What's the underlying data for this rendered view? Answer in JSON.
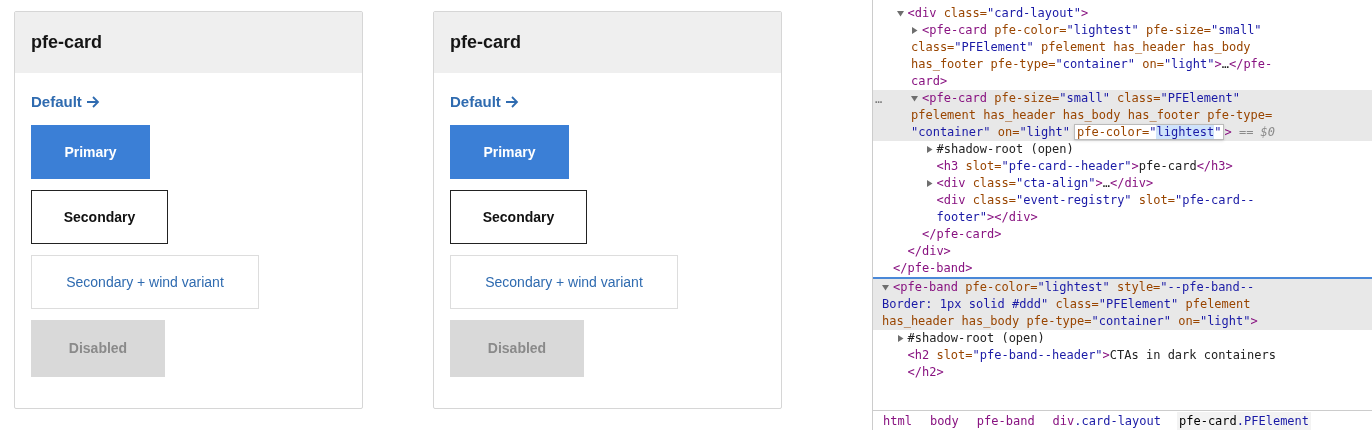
{
  "cards": [
    {
      "header": "pfe-card",
      "link": "Default",
      "buttons": [
        {
          "label": "Primary",
          "kind": "primary"
        },
        {
          "label": "Secondary",
          "kind": "secondary"
        },
        {
          "label": "Secondary + wind variant",
          "kind": "wind"
        },
        {
          "label": "Disabled",
          "kind": "disabled"
        }
      ]
    },
    {
      "header": "pfe-card",
      "link": "Default",
      "buttons": [
        {
          "label": "Primary",
          "kind": "primary"
        },
        {
          "label": "Secondary",
          "kind": "secondary"
        },
        {
          "label": "Secondary + wind variant",
          "kind": "wind"
        },
        {
          "label": "Disabled",
          "kind": "disabled"
        }
      ]
    }
  ],
  "elements": [
    {
      "closing": [
        {
          "kind": "tag",
          "text": "</pfe-band>"
        }
      ],
      "children": [
        {
          "highlighted": false,
          "expanded": true,
          "lines": [
            [
              {
                "kind": "tag",
                "text": "<div"
              },
              {
                "kind": "attr",
                "text": " class="
              },
              {
                "kind": "val",
                "text": "\"card-layout\""
              },
              {
                "kind": "tag",
                "text": ">"
              }
            ]
          ],
          "closing": [
            {
              "kind": "tag",
              "text": "</div>"
            }
          ],
          "children": [
            {
              "highlighted": false,
              "expanded": false,
              "lines": [
                [
                  {
                    "kind": "tag",
                    "text": "<pfe-card"
                  },
                  {
                    "kind": "attr",
                    "text": " pfe-color="
                  },
                  {
                    "kind": "val",
                    "text": "\"lightest\""
                  },
                  {
                    "kind": "attr",
                    "text": " pfe-size="
                  },
                  {
                    "kind": "val",
                    "text": "\"small\""
                  }
                ],
                [
                  {
                    "kind": "attr",
                    "text": "class="
                  },
                  {
                    "kind": "val",
                    "text": "\"PFElement\""
                  },
                  {
                    "kind": "attr",
                    "text": " pfelement has_header has_body"
                  }
                ],
                [
                  {
                    "kind": "attr",
                    "text": "has_footer pfe-type="
                  },
                  {
                    "kind": "val",
                    "text": "\"container\""
                  },
                  {
                    "kind": "attr",
                    "text": " on="
                  },
                  {
                    "kind": "val",
                    "text": "\"light\""
                  },
                  {
                    "kind": "tag",
                    "text": ">"
                  },
                  {
                    "kind": "plain",
                    "text": "…"
                  },
                  {
                    "kind": "tag",
                    "text": "</pfe-"
                  }
                ],
                [
                  {
                    "kind": "tag",
                    "text": "card>"
                  }
                ]
              ]
            },
            {
              "highlighted": true,
              "gutter": "…",
              "expanded": true,
              "lines": [
                [
                  {
                    "kind": "tag",
                    "text": "<pfe-card"
                  },
                  {
                    "kind": "attr",
                    "text": " pfe-size="
                  },
                  {
                    "kind": "val",
                    "text": "\"small\""
                  },
                  {
                    "kind": "attr",
                    "text": " class="
                  },
                  {
                    "kind": "val",
                    "text": "\"PFElement\""
                  }
                ],
                [
                  {
                    "kind": "attr",
                    "text": "pfelement has_header has_body has_footer pfe-type="
                  }
                ],
                [
                  {
                    "kind": "val",
                    "text": "\"container\""
                  },
                  {
                    "kind": "attr",
                    "text": " on="
                  },
                  {
                    "kind": "val",
                    "text": "\"light\""
                  },
                  {
                    "kind": "edit",
                    "parts": [
                      {
                        "kind": "attr",
                        "text": "pfe-color="
                      },
                      {
                        "kind": "val",
                        "text": "\""
                      },
                      {
                        "kind": "sel",
                        "text": "lightest"
                      },
                      {
                        "kind": "val",
                        "text": "\""
                      }
                    ]
                  },
                  {
                    "kind": "tag",
                    "text": ">"
                  },
                  {
                    "kind": "dim",
                    "text": " == $0"
                  }
                ]
              ],
              "closing": [
                {
                  "kind": "tag",
                  "text": "</pfe-card>"
                }
              ],
              "children": [
                {
                  "highlighted": false,
                  "expanded": false,
                  "lines": [
                    [
                      {
                        "kind": "plain",
                        "text": "#shadow-root (open)"
                      }
                    ]
                  ]
                },
                {
                  "highlighted": false,
                  "lines": [
                    [
                      {
                        "kind": "tag",
                        "text": "<h3"
                      },
                      {
                        "kind": "attr",
                        "text": " slot="
                      },
                      {
                        "kind": "val",
                        "text": "\"pfe-card--header\""
                      },
                      {
                        "kind": "tag",
                        "text": ">"
                      },
                      {
                        "kind": "plain",
                        "text": "pfe-card"
                      },
                      {
                        "kind": "tag",
                        "text": "</h3>"
                      }
                    ]
                  ]
                },
                {
                  "highlighted": false,
                  "expanded": false,
                  "lines": [
                    [
                      {
                        "kind": "tag",
                        "text": "<div"
                      },
                      {
                        "kind": "attr",
                        "text": " class="
                      },
                      {
                        "kind": "val",
                        "text": "\"cta-align\""
                      },
                      {
                        "kind": "tag",
                        "text": ">"
                      },
                      {
                        "kind": "plain",
                        "text": "…"
                      },
                      {
                        "kind": "tag",
                        "text": "</div>"
                      }
                    ]
                  ]
                },
                {
                  "highlighted": false,
                  "lines": [
                    [
                      {
                        "kind": "tag",
                        "text": "<div"
                      },
                      {
                        "kind": "attr",
                        "text": " class="
                      },
                      {
                        "kind": "val",
                        "text": "\"event-registry\""
                      },
                      {
                        "kind": "attr",
                        "text": " slot="
                      },
                      {
                        "kind": "val",
                        "text": "\"pfe-card--"
                      }
                    ],
                    [
                      {
                        "kind": "val",
                        "text": "footer\""
                      },
                      {
                        "kind": "tag",
                        "text": "></div>"
                      }
                    ]
                  ]
                }
              ]
            }
          ]
        }
      ]
    },
    {
      "highlighted": true,
      "drop_line": true,
      "expanded": true,
      "lines": [
        [
          {
            "kind": "tag",
            "text": "<pfe-band"
          },
          {
            "kind": "attr",
            "text": " pfe-color="
          },
          {
            "kind": "val",
            "text": "\"lightest\""
          },
          {
            "kind": "attr",
            "text": " style="
          },
          {
            "kind": "val",
            "text": "\"--pfe-band--"
          }
        ],
        [
          {
            "kind": "val",
            "text": "Border: 1px solid #ddd\""
          },
          {
            "kind": "attr",
            "text": " class="
          },
          {
            "kind": "val",
            "text": "\"PFElement\""
          },
          {
            "kind": "attr",
            "text": " pfelement"
          }
        ],
        [
          {
            "kind": "attr",
            "text": "has_header has_body pfe-type="
          },
          {
            "kind": "val",
            "text": "\"container\""
          },
          {
            "kind": "attr",
            "text": " on="
          },
          {
            "kind": "val",
            "text": "\"light\""
          },
          {
            "kind": "tag",
            "text": ">"
          }
        ]
      ],
      "children": [
        {
          "highlighted": false,
          "expanded": false,
          "lines": [
            [
              {
                "kind": "plain",
                "text": "#shadow-root (open)"
              }
            ]
          ]
        },
        {
          "highlighted": false,
          "lines": [
            [
              {
                "kind": "tag",
                "text": "<h2"
              },
              {
                "kind": "attr",
                "text": " slot="
              },
              {
                "kind": "val",
                "text": "\"pfe-band--header\""
              },
              {
                "kind": "tag",
                "text": ">"
              },
              {
                "kind": "plain",
                "text": "CTAs in dark containers"
              }
            ],
            [
              {
                "kind": "tag",
                "text": "</h2>"
              }
            ]
          ]
        }
      ]
    }
  ],
  "breadcrumbs": [
    {
      "tag": "html",
      "selected": false
    },
    {
      "tag": "body",
      "selected": false
    },
    {
      "tag": "pfe-band",
      "selected": false
    },
    {
      "tag": "div",
      "cls": ".card-layout",
      "selected": false
    },
    {
      "tag": "pfe-card",
      "cls": ".PFElement",
      "selected": true
    }
  ]
}
